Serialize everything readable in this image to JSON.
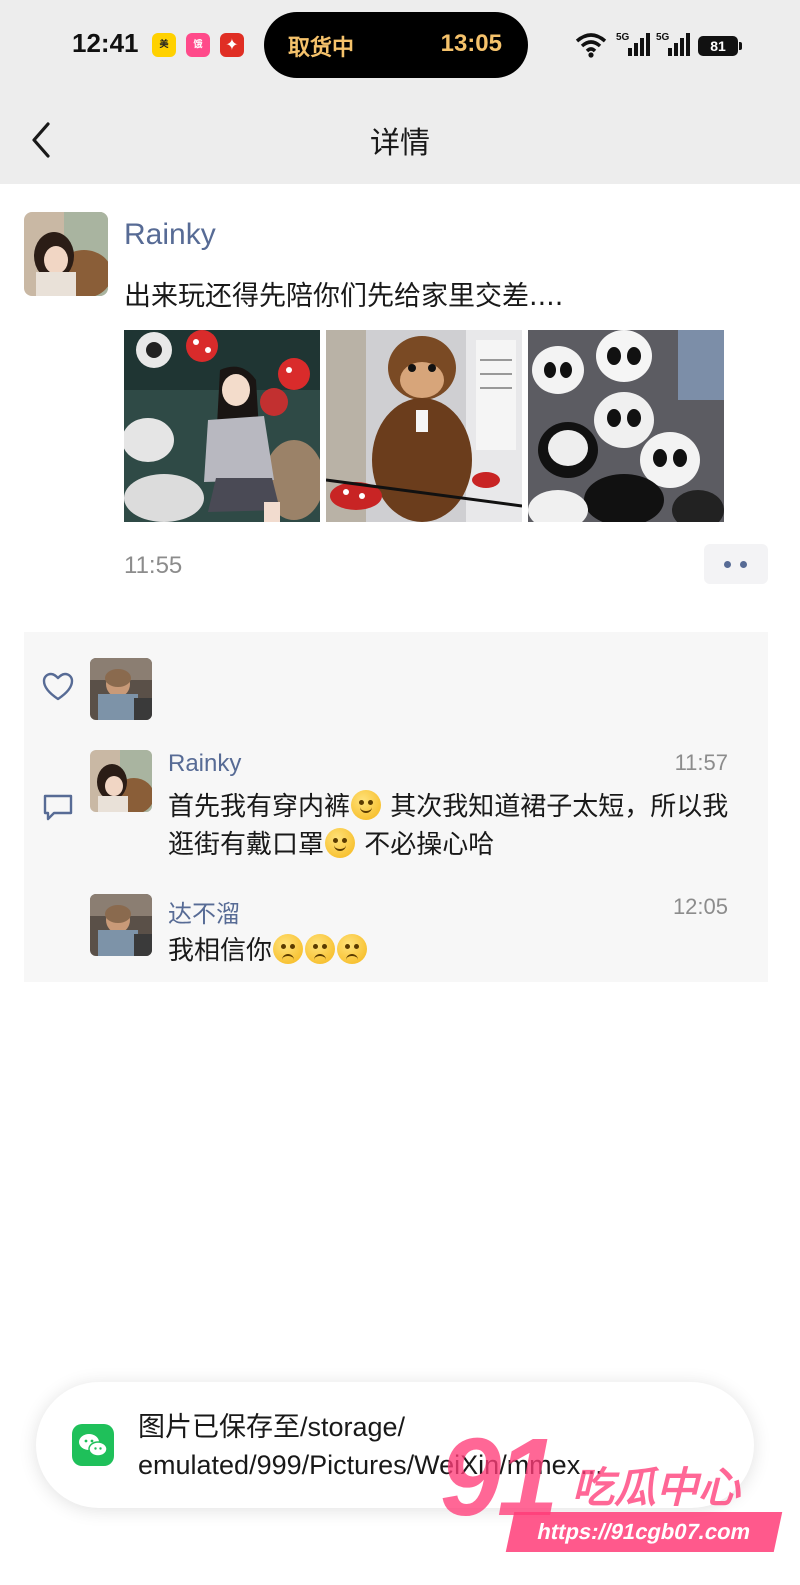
{
  "status_bar": {
    "time": "12:41",
    "apps": [
      "美团",
      "饿了么",
      "拼多多"
    ],
    "island_label": "取货中",
    "island_time": "13:05",
    "network": [
      "wifi-icon",
      "5g-signal-icon",
      "5g-signal-icon"
    ],
    "battery": "81"
  },
  "nav": {
    "title": "详情",
    "back_icon": "chevron-left-icon"
  },
  "post": {
    "author": "Rainky",
    "text": "出来玩还得先陪你们先给家里交差....",
    "photos": [
      "girl-with-plush-toys",
      "monkey-plush",
      "panda-plush-toys"
    ],
    "time": "11:55",
    "more_icon": "more-dots-icon"
  },
  "interactions": {
    "like_icon": "heart-outline-icon",
    "comment_icon": "comment-bubble-icon",
    "comments": [
      {
        "author": "Rainky",
        "time": "11:57",
        "text_part1": "首先我有穿内裤",
        "text_part2": " 其次我知道裙子太短，所以我逛街有戴口罩",
        "text_part3": " 不必操心哈"
      },
      {
        "author": "达不溜",
        "time": "12:05",
        "text": "我相信你"
      }
    ]
  },
  "toast": {
    "line1": "图片已保存至/storage/",
    "line2": "emulated/999/Pictures/WeiXin/mmex..."
  },
  "watermark": {
    "number": "91",
    "brand": "吃瓜中心",
    "url": "https://91cgb07.com"
  },
  "colors": {
    "link_blue": "#576b95",
    "wechat_green": "#1fc05a",
    "header_bg": "#ededed"
  }
}
